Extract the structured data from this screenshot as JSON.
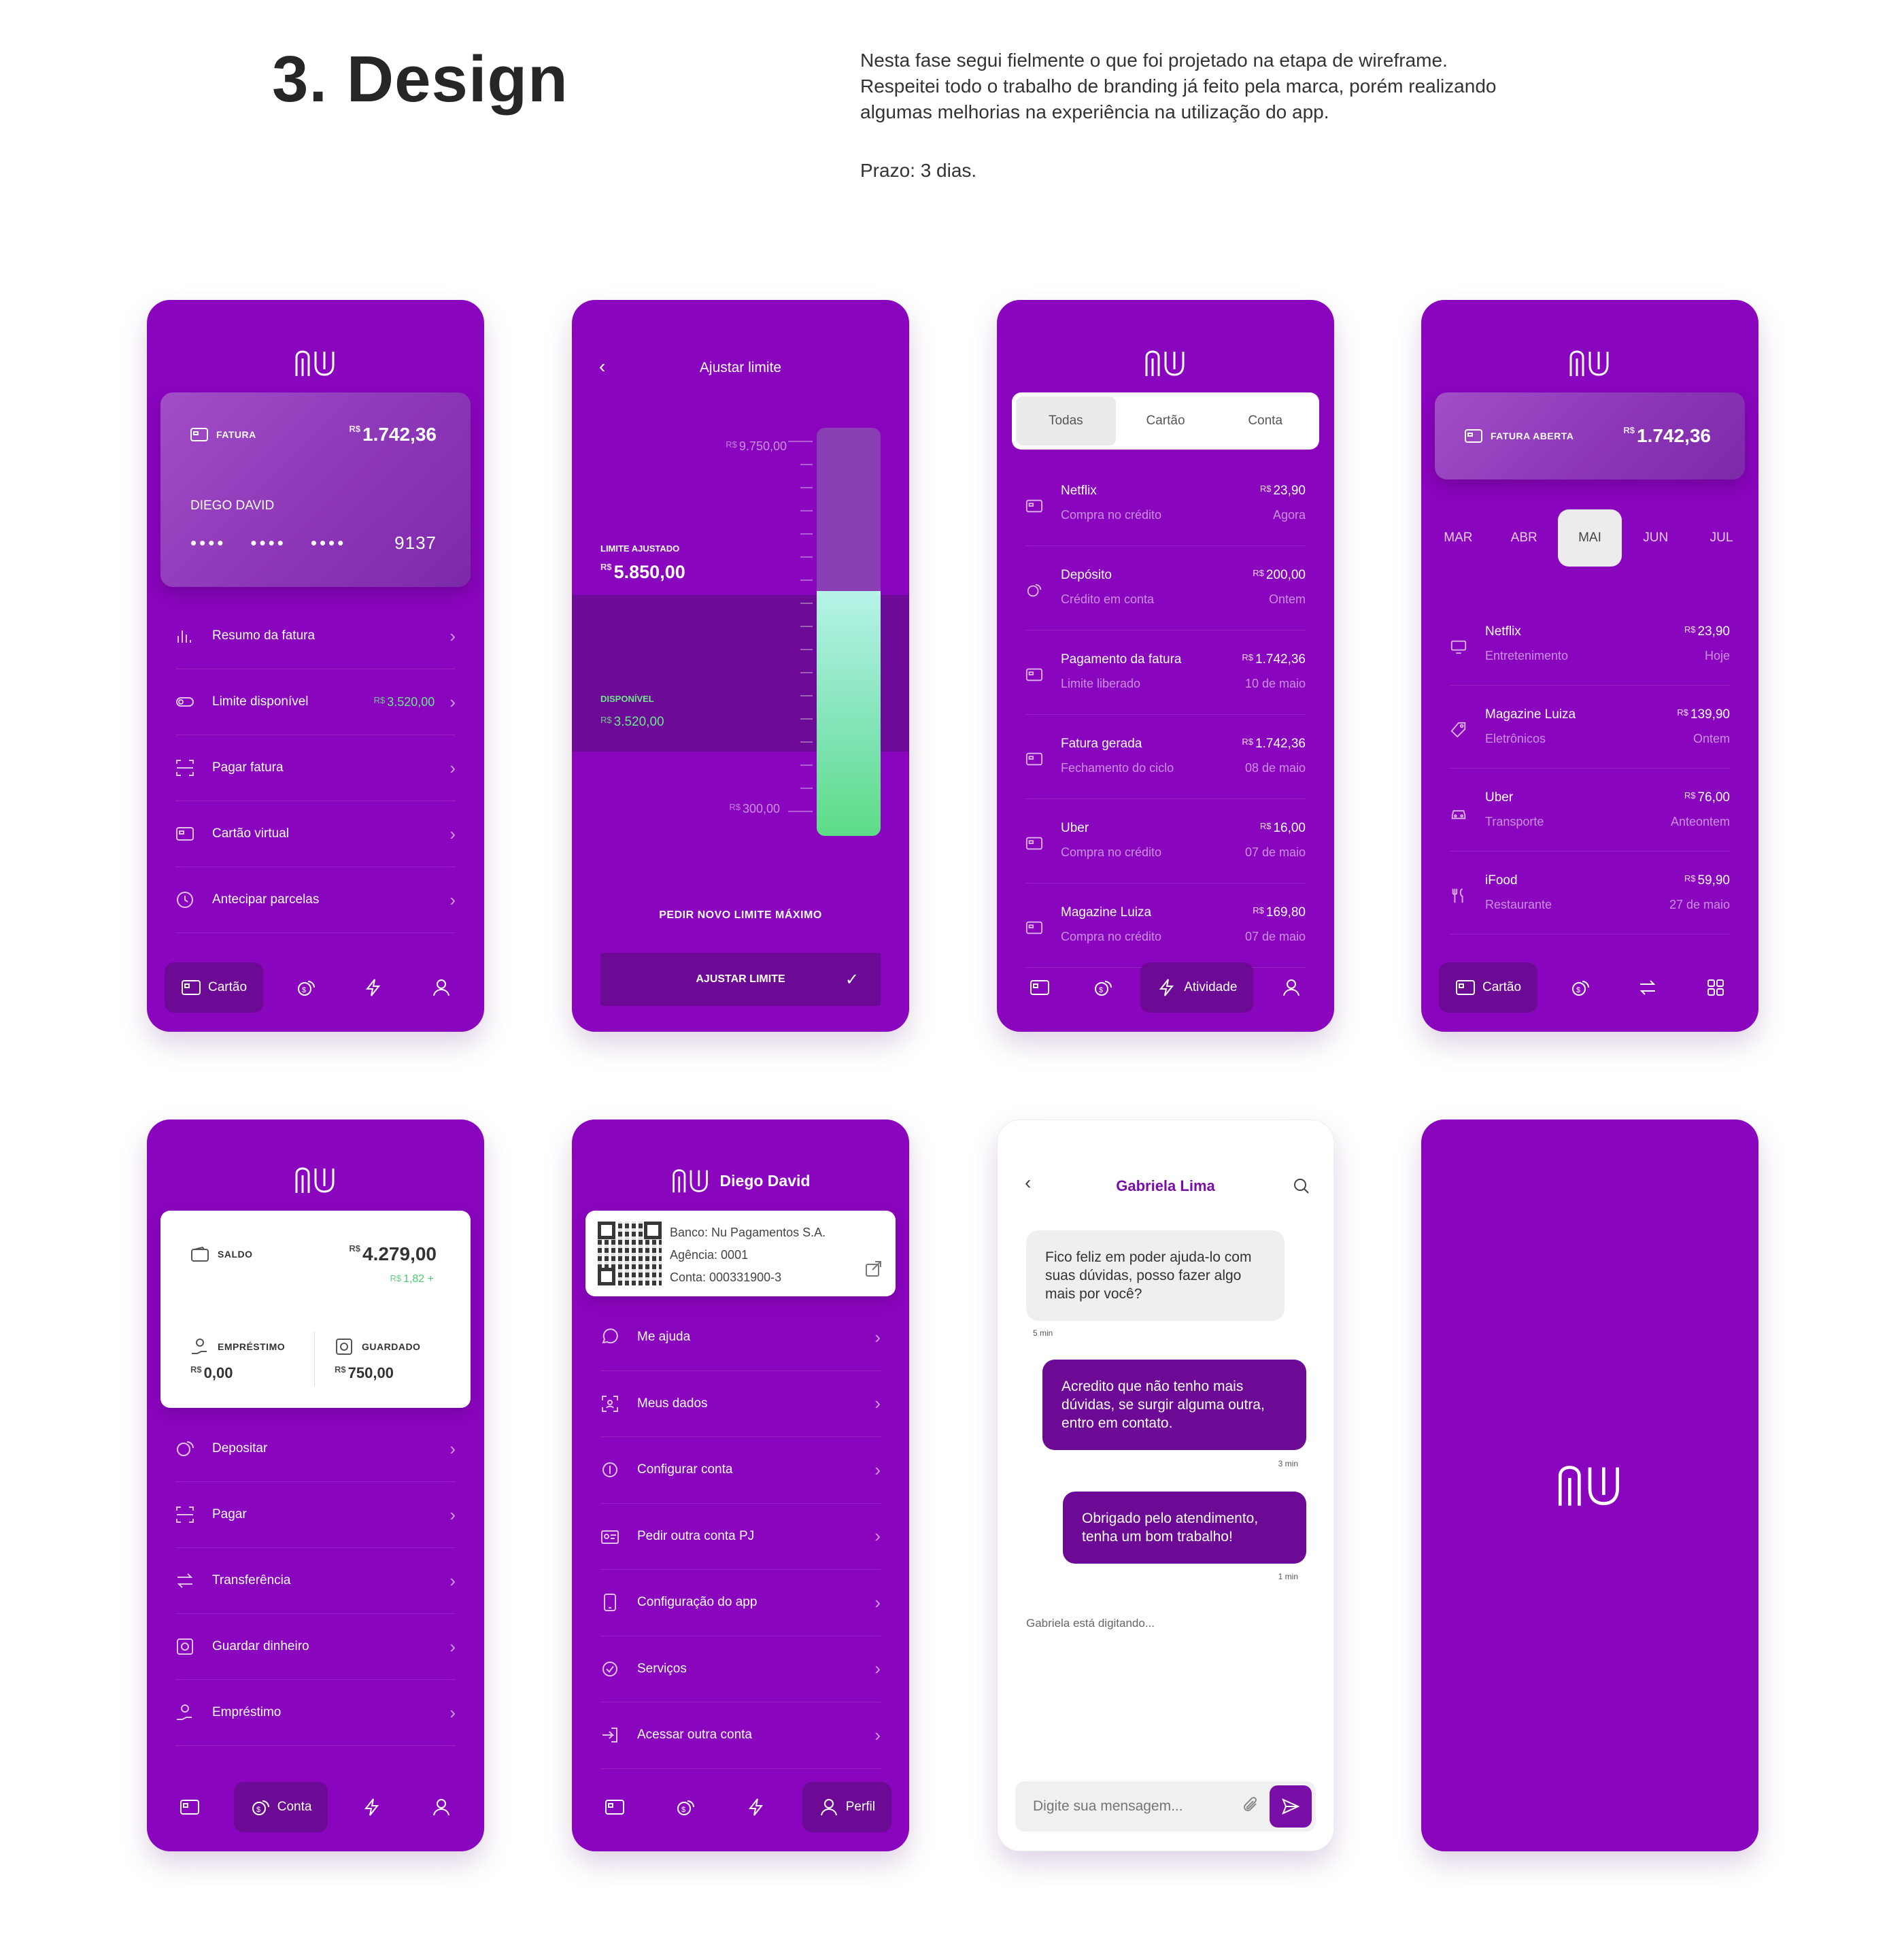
{
  "header": {
    "title": "3. Design",
    "intro": [
      "Nesta fase segui fielmente o que foi projetado na etapa de wireframe.",
      "Respeitei todo o trabalho de branding já feito pela marca, porém realizando",
      "algumas melhorias na experiência na utilização do app."
    ],
    "deadline": "Prazo: 3 dias."
  },
  "colors": {
    "brand": "#8a05be",
    "dark": "#6c0a95",
    "green": "#6ee68c"
  },
  "currency": "R$",
  "screen1": {
    "card": {
      "tag": "FATURA",
      "amount": "1.742,36",
      "holder": "DIEGO DAVID",
      "masked": [
        "••••",
        "••••",
        "••••"
      ],
      "last4": "9137"
    },
    "menu": [
      {
        "label": "Resumo da fatura",
        "icon": "chart-icon"
      },
      {
        "label": "Limite disponível",
        "value": "3.520,00",
        "icon": "toggle-icon"
      },
      {
        "label": "Pagar fatura",
        "icon": "barcode-icon"
      },
      {
        "label": "Cartão virtual",
        "icon": "card-icon"
      },
      {
        "label": "Antecipar parcelas",
        "icon": "clock-icon"
      }
    ],
    "nav_active": "Cartão"
  },
  "screen2": {
    "title": "Ajustar limite",
    "max_label": "9.750,00",
    "adjusted_tag": "LIMITE AJUSTADO",
    "adjusted_value": "5.850,00",
    "available_tag": "DISPONÍVEL",
    "available_value": "3.520,00",
    "min_label": "300,00",
    "request_label": "PEDIR NOVO LIMITE MÁXIMO",
    "button_label": "AJUSTAR LIMITE",
    "slider_level": 0.6
  },
  "screen3": {
    "tabs": [
      "Todas",
      "Cartão",
      "Conta"
    ],
    "transactions": [
      {
        "name": "Netflix",
        "sub": "Compra no crédito",
        "amount": "23,90",
        "date": "Agora"
      },
      {
        "name": "Depósito",
        "sub": "Crédito em conta",
        "amount": "200,00",
        "date": "Ontem"
      },
      {
        "name": "Pagamento da fatura",
        "sub": "Limite liberado",
        "amount": "1.742,36",
        "date": "10 de maio"
      },
      {
        "name": "Fatura gerada",
        "sub": "Fechamento do ciclo",
        "amount": "1.742,36",
        "date": "08 de maio"
      },
      {
        "name": "Uber",
        "sub": "Compra no crédito",
        "amount": "16,00",
        "date": "07 de maio"
      },
      {
        "name": "Magazine Luiza",
        "sub": "Compra no crédito",
        "amount": "169,80",
        "date": "07 de maio"
      }
    ],
    "nav_active": "Atividade"
  },
  "screen4": {
    "card": {
      "tag": "FATURA ABERTA",
      "amount": "1.742,36"
    },
    "months": [
      "MAR",
      "ABR",
      "MAI",
      "JUN",
      "JUL"
    ],
    "active_month": "MAI",
    "transactions": [
      {
        "name": "Netflix",
        "sub": "Entretenimento",
        "amount": "23,90",
        "date": "Hoje"
      },
      {
        "name": "Magazine Luiza",
        "sub": "Eletrônicos",
        "amount": "139,90",
        "date": "Ontem"
      },
      {
        "name": "Uber",
        "sub": "Transporte",
        "amount": "76,00",
        "date": "Anteontem"
      },
      {
        "name": "iFood",
        "sub": "Restaurante",
        "amount": "59,90",
        "date": "27 de maio"
      }
    ],
    "nav_active": "Cartão"
  },
  "screen5": {
    "balance_tag": "SALDO",
    "balance": "4.279,00",
    "delta": "1,82",
    "loan_tag": "EMPRÉSTIMO",
    "loan_value": "0,00",
    "saved_tag": "GUARDADO",
    "saved_value": "750,00",
    "menu": [
      {
        "label": "Depositar",
        "icon": "coin-icon"
      },
      {
        "label": "Pagar",
        "icon": "barcode-icon"
      },
      {
        "label": "Transferência",
        "icon": "transfer-icon"
      },
      {
        "label": "Guardar dinheiro",
        "icon": "safe-icon"
      },
      {
        "label": "Empréstimo",
        "icon": "loan-icon"
      }
    ],
    "nav_active": "Conta"
  },
  "screen6": {
    "name": "Diego David",
    "bank": "Banco: Nu Pagamentos S.A.",
    "agency": "Agência: 0001",
    "account": "Conta: 000331900-3",
    "menu": [
      {
        "label": "Me ajuda",
        "icon": "chat-icon"
      },
      {
        "label": "Meus dados",
        "icon": "face-id-icon"
      },
      {
        "label": "Configurar conta",
        "icon": "money-settings-icon"
      },
      {
        "label": "Pedir outra conta PJ",
        "icon": "id-card-icon"
      },
      {
        "label": "Configuração do app",
        "icon": "phone-settings-icon"
      },
      {
        "label": "Serviços",
        "icon": "services-icon"
      },
      {
        "label": "Acessar outra conta",
        "icon": "login-icon"
      }
    ],
    "nav_active": "Perfil"
  },
  "screen7": {
    "contact": "Gabriela Lima",
    "messages": [
      {
        "from": "in",
        "text": "Fico feliz em poder ajuda-lo com suas dúvidas, posso fazer algo mais por você?",
        "time": "5 min"
      },
      {
        "from": "out",
        "text": "Acredito que não tenho mais dúvidas, se surgir alguma outra, entro em contato.",
        "time": "3 min"
      },
      {
        "from": "out",
        "text": "Obrigado pelo atendimento, tenha um bom trabalho!",
        "time": "1 min"
      }
    ],
    "typing": "Gabriela está digitando...",
    "input_placeholder": "Digite sua mensagem..."
  }
}
